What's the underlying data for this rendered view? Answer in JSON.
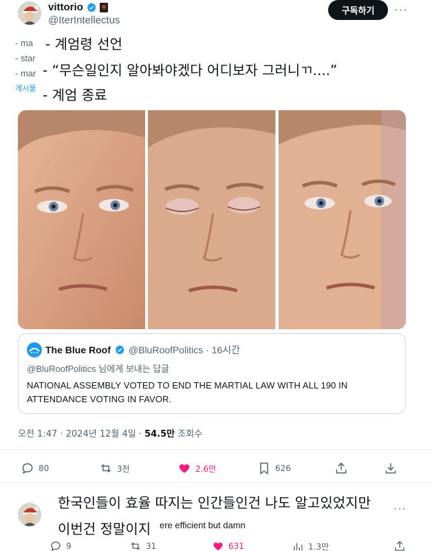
{
  "post": {
    "display_name": "vittorio",
    "handle": "@IterIntellectus",
    "subscribe_label": "구독하기",
    "more_label": "···",
    "original_lines": [
      "- ma",
      "- star",
      "- mar",
      "게시물"
    ],
    "overlay_lines": [
      "- 계엄령 선언",
      "- “무슨일인지 알아봐야겠다 어디보자 그러니ㄲ....”",
      "- 계엄 종료"
    ]
  },
  "quote": {
    "name": "The Blue Roof",
    "handle_time": "@BluRoofPolitics · 16시간",
    "reply_to": "@BluRoofPolitics 님에게 보내는 답글",
    "body": "NATIONAL ASSEMBLY VOTED TO END THE MARTIAL LAW WITH ALL 190 IN ATTENDANCE VOTING IN FAVOR."
  },
  "meta": {
    "timestamp": "오전 1:47 · 2024년 12월 4일 · ",
    "views_count": "54.5만",
    "views_label": "조회수"
  },
  "actions": {
    "replies": "80",
    "reposts": "3천",
    "likes": "2.6만",
    "bookmarks": "626"
  },
  "reply": {
    "overlay_line1": "한국인들이 효율 따지는 인간들인건 나도 알고있었지만",
    "overlay_line2": "이번건 정말이지",
    "visible_text": "ere efficient but damn",
    "more_label": "···",
    "replies": "9",
    "reposts": "31",
    "likes": "631",
    "views": "1.3만"
  },
  "colors": {
    "accent_blue": "#1d9bf0",
    "like_pink": "#f91880",
    "text_primary": "#0f1419",
    "text_secondary": "#536471"
  }
}
